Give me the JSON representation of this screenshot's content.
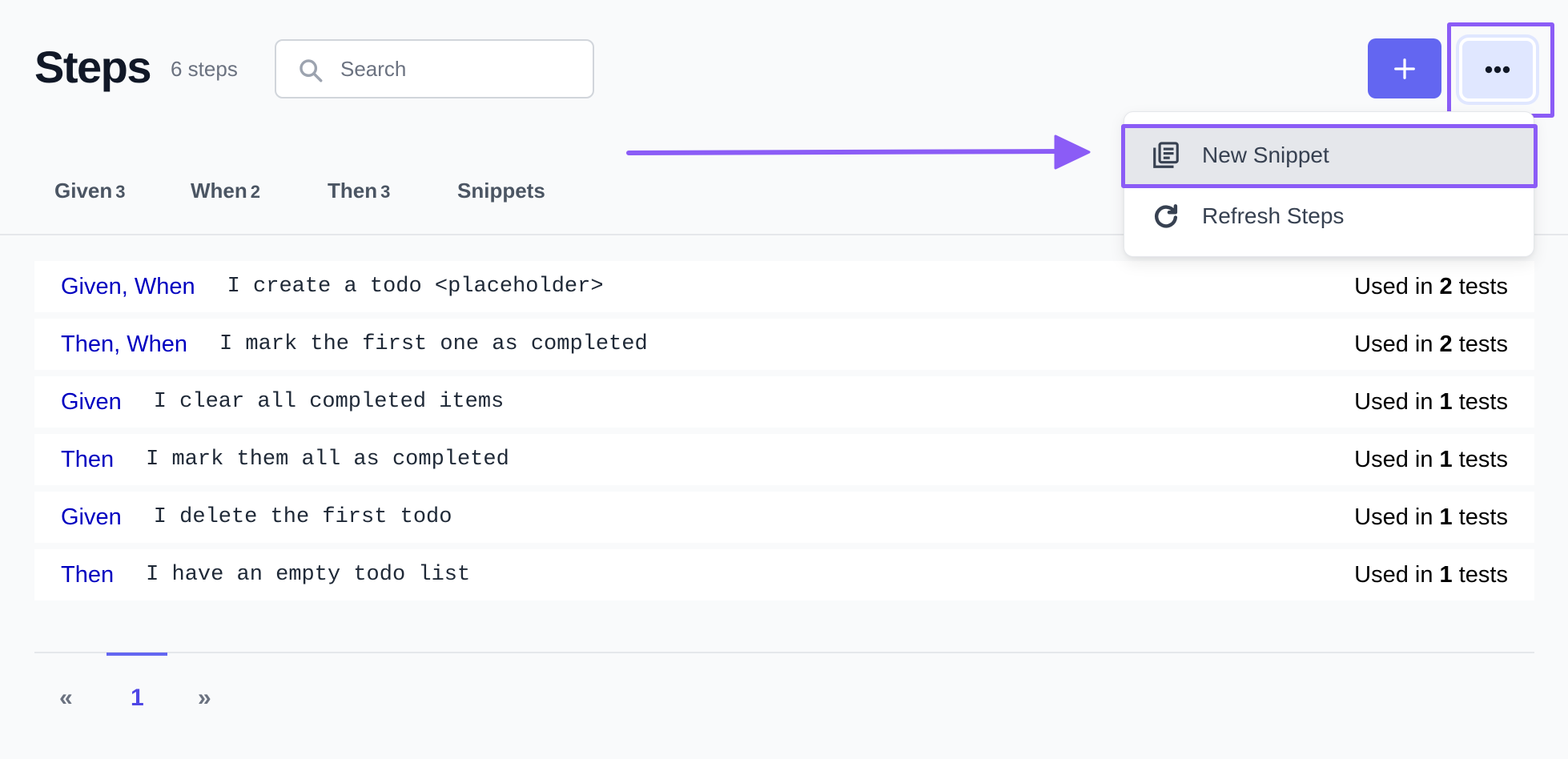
{
  "header": {
    "title": "Steps",
    "count": "6 steps",
    "search_placeholder": "Search",
    "search_value": "",
    "add_button_label": "+",
    "more_button_label": "•••"
  },
  "tabs": [
    {
      "label": "Given",
      "count": "3"
    },
    {
      "label": "When",
      "count": "2"
    },
    {
      "label": "Then",
      "count": "3"
    },
    {
      "label": "Snippets",
      "count": ""
    }
  ],
  "menu": {
    "items": [
      {
        "label": "New Snippet",
        "icon": "snippet-icon",
        "highlighted": true
      },
      {
        "label": "Refresh Steps",
        "icon": "refresh-icon",
        "highlighted": false
      }
    ]
  },
  "steps": [
    {
      "keywords": "Given, When",
      "text": "I create a todo <placeholder>",
      "usage_prefix": "Used in",
      "usage_count": "2",
      "usage_suffix": "tests"
    },
    {
      "keywords": "Then, When",
      "text": "I mark the first one as completed",
      "usage_prefix": "Used in",
      "usage_count": "2",
      "usage_suffix": "tests"
    },
    {
      "keywords": "Given",
      "text": "I clear all completed items",
      "usage_prefix": "Used in",
      "usage_count": "1",
      "usage_suffix": "tests"
    },
    {
      "keywords": "Then",
      "text": "I mark them all as completed",
      "usage_prefix": "Used in",
      "usage_count": "1",
      "usage_suffix": "tests"
    },
    {
      "keywords": "Given",
      "text": "I delete the first todo",
      "usage_prefix": "Used in",
      "usage_count": "1",
      "usage_suffix": "tests"
    },
    {
      "keywords": "Then",
      "text": "I have an empty todo list",
      "usage_prefix": "Used in",
      "usage_count": "1",
      "usage_suffix": "tests"
    }
  ],
  "pagination": {
    "prev": "«",
    "current_page": "1",
    "next": "»"
  },
  "colors": {
    "accent": "#6366f1",
    "annotation": "#8b5cf6",
    "keyword": "#0000c0"
  }
}
